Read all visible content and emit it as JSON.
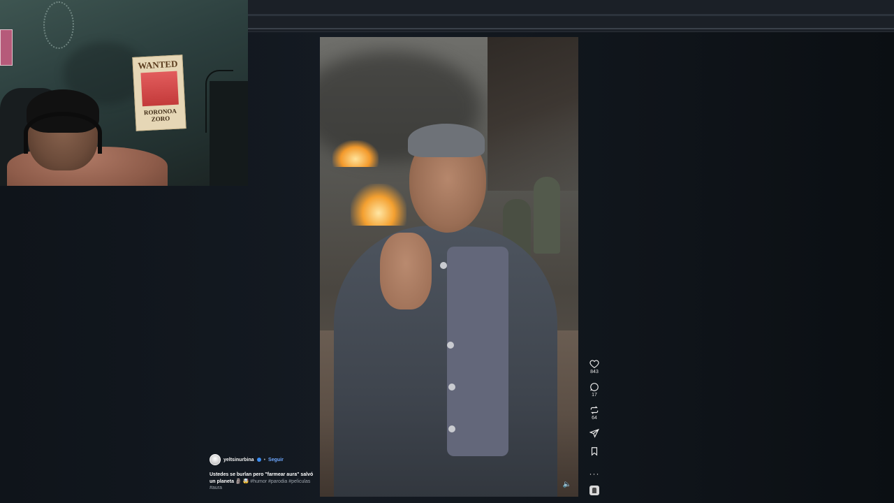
{
  "post": {
    "author": "yeltsinurbina",
    "follow_label": "Seguir",
    "separator": "•",
    "caption_lead": "Ustedes se burlan pero \"farmear aura\" salvó un planeta",
    "emoji": "🗿 🤯",
    "hashtags": [
      "#humor",
      "#parodia",
      "#peliculas",
      "#aura"
    ]
  },
  "actions": {
    "likes": "843",
    "comments": "17",
    "reposts": "64",
    "more_label": "···"
  },
  "webcam": {
    "poster_title": "WANTED",
    "poster_name": "RORONOA ZORO"
  },
  "colors": {
    "background": "#0d1115",
    "follow_link": "#6ea8ff",
    "verified_badge": "#3b8cf0"
  }
}
